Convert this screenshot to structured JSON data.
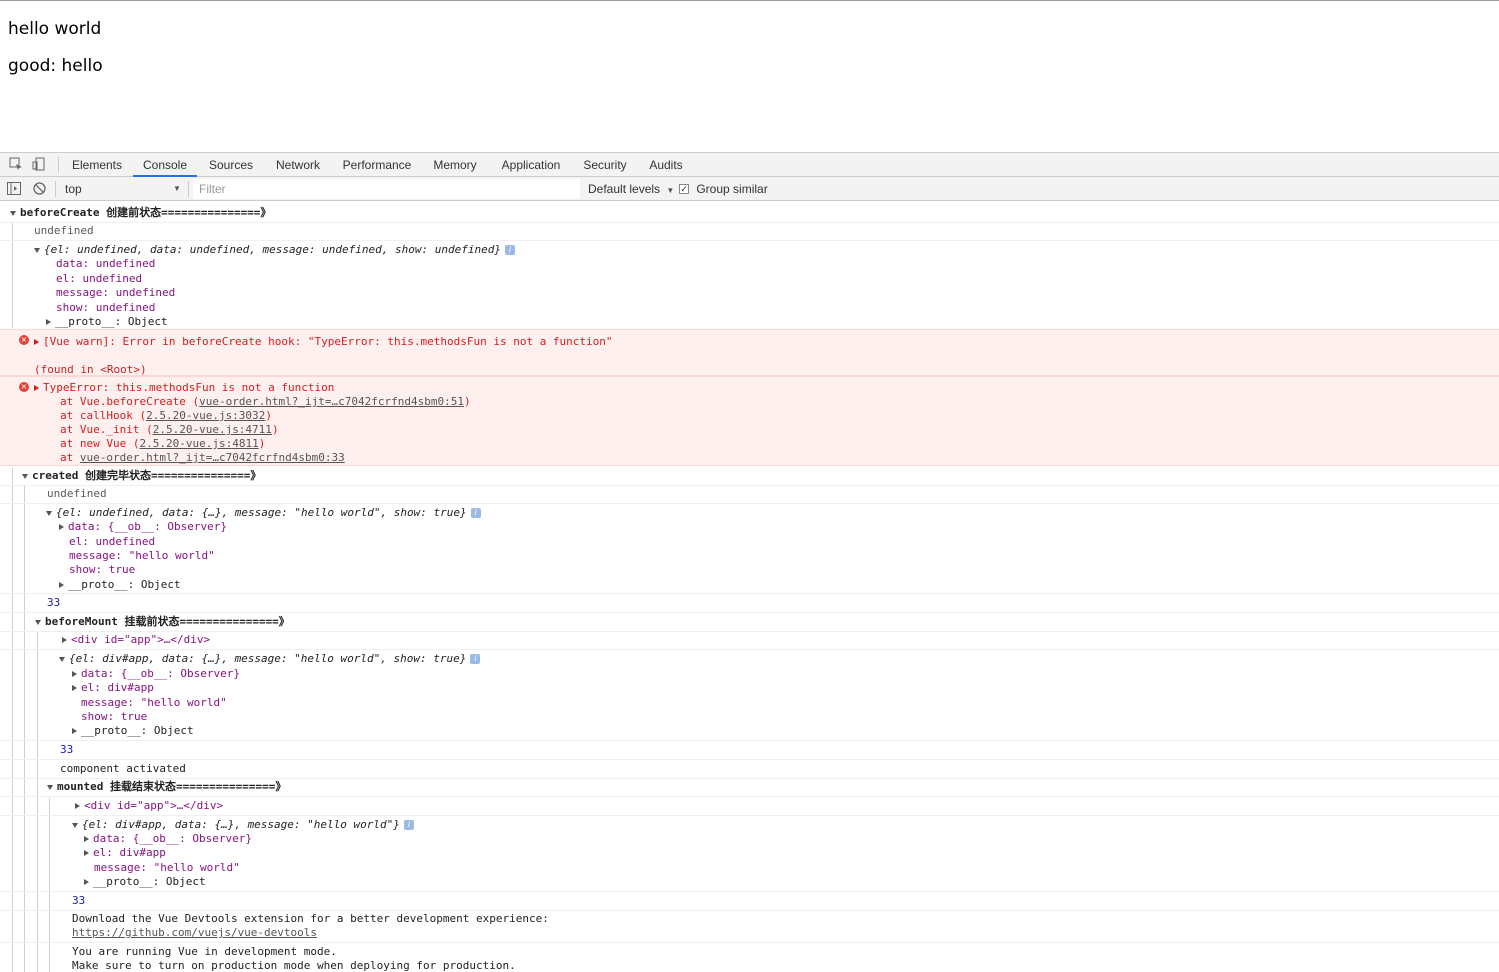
{
  "page": {
    "line1": "hello world",
    "line2": "good: hello"
  },
  "devtools": {
    "tabs": [
      "Elements",
      "Console",
      "Sources",
      "Network",
      "Performance",
      "Memory",
      "Application",
      "Security",
      "Audits"
    ],
    "active_tab": "Console",
    "toolbar": {
      "context": "top",
      "filter_placeholder": "Filter",
      "levels": "Default levels",
      "group_similar": "Group similar"
    }
  },
  "console": {
    "beforeCreate": {
      "header": "beforeCreate 创建前状态===============》",
      "undefined": "undefined",
      "obj_summary": "{el: undefined, data: undefined, message: undefined, show: undefined}",
      "props": [
        "data: undefined",
        "el: undefined",
        "message: undefined",
        "show: undefined"
      ],
      "proto": "__proto__: Object"
    },
    "warn": {
      "line1": "[Vue warn]: Error in beforeCreate hook: \"TypeError: this.methodsFun is not a function\"",
      "line2": "(found in <Root>)"
    },
    "typeerror": {
      "title": "TypeError: this.methodsFun is not a function",
      "stack": [
        {
          "text": "at Vue.beforeCreate (",
          "link": "vue-order.html?_ijt=…c7042fcrfnd4sbm0:51",
          "end": ")"
        },
        {
          "text": "at callHook (",
          "link": "2.5.20-vue.js:3032",
          "end": ")"
        },
        {
          "text": "at Vue._init (",
          "link": "2.5.20-vue.js:4711",
          "end": ")"
        },
        {
          "text": "at new Vue (",
          "link": "2.5.20-vue.js:4811",
          "end": ")"
        },
        {
          "text": "at ",
          "link": "vue-order.html?_ijt=…c7042fcrfnd4sbm0:33",
          "end": ""
        }
      ]
    },
    "created": {
      "header": "created 创建完毕状态===============》",
      "undefined": "undefined",
      "obj_summary": "{el: undefined, data: {…}, message: \"hello world\", show: true}",
      "data": "data: {__ob__: Observer}",
      "el": "el: undefined",
      "message": "message: \"hello world\"",
      "show": "show: true",
      "proto": "__proto__: Object",
      "num": "33"
    },
    "beforeMount": {
      "header": "beforeMount 挂载前状态===============》",
      "div": "<div id=\"app\">…</div>",
      "obj_summary": "{el: div#app, data: {…}, message: \"hello world\", show: true}",
      "data": "data: {__ob__: Observer}",
      "el": "el: div#app",
      "message": "message: \"hello world\"",
      "show": "show: true",
      "proto": "__proto__: Object",
      "num": "33",
      "activated": "component activated"
    },
    "mounted": {
      "header": "mounted 挂载结束状态===============》",
      "div": "<div id=\"app\">…</div>",
      "obj_summary": "{el: div#app, data: {…}, message: \"hello world\"}",
      "data": "data: {__ob__: Observer}",
      "el": "el: div#app",
      "message": "message: \"hello world\"",
      "proto": "__proto__: Object",
      "num": "33"
    },
    "devtools_msg": {
      "line1": "Download the Vue Devtools extension for a better development experience:",
      "link": "https://github.com/vuejs/vue-devtools"
    },
    "dev_mode": {
      "line1": "You are running Vue in development mode.",
      "line2": "Make sure to turn on production mode when deploying for production."
    }
  }
}
